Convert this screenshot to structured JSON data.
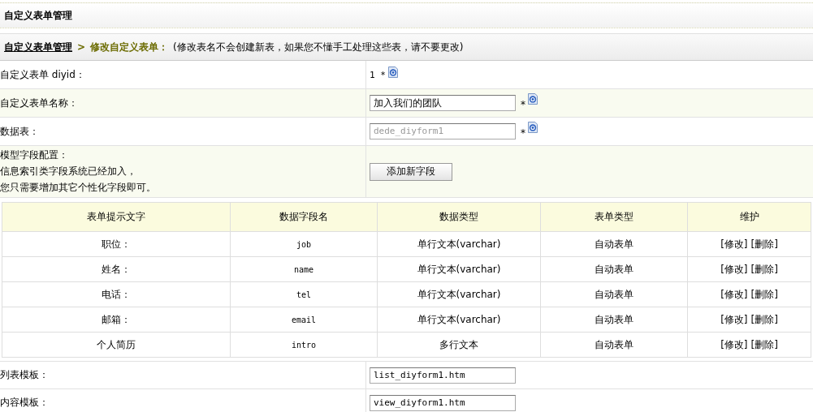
{
  "header": {
    "title": "自定义表单管理"
  },
  "breadcrumb": {
    "link": "自定义表单管理",
    "separator": ">",
    "current": "修改自定义表单：",
    "note": "(修改表名不会创建新表，如果您不懂手工处理这些表，请不要更改)"
  },
  "form_rows": [
    {
      "kind": "text",
      "label": "自定义表单 diyid：",
      "value": "1 *",
      "help": true
    },
    {
      "kind": "input",
      "label": "自定义表单名称：",
      "value": "加入我们的团队",
      "disabled": false,
      "required": "*",
      "help": true
    },
    {
      "kind": "input",
      "label": "数据表：",
      "value": "dede_diyform1",
      "disabled": true,
      "required": "*",
      "help": true
    },
    {
      "kind": "button",
      "label_lines": [
        "模型字段配置：",
        "信息索引类字段系统已经加入，",
        "您只需要增加其它个性化字段即可。"
      ],
      "button": "添加新字段"
    }
  ],
  "fields_table": {
    "columns": [
      "表单提示文字",
      "数据字段名",
      "数据类型",
      "表单类型",
      "维护"
    ],
    "rows": [
      {
        "prompt": "职位：",
        "field": "job",
        "data_type": "单行文本(varchar)",
        "form_type": "自动表单",
        "actions": [
          "[修改]",
          "[删除]"
        ]
      },
      {
        "prompt": "姓名：",
        "field": "name",
        "data_type": "单行文本(varchar)",
        "form_type": "自动表单",
        "actions": [
          "[修改]",
          "[删除]"
        ]
      },
      {
        "prompt": "电话：",
        "field": "tel",
        "data_type": "单行文本(varchar)",
        "form_type": "自动表单",
        "actions": [
          "[修改]",
          "[删除]"
        ]
      },
      {
        "prompt": "邮箱：",
        "field": "email",
        "data_type": "单行文本(varchar)",
        "form_type": "自动表单",
        "actions": [
          "[修改]",
          "[删除]"
        ]
      },
      {
        "prompt": "个人简历",
        "field": "intro",
        "data_type": "多行文本",
        "form_type": "自动表单",
        "actions": [
          "[修改]",
          "[删除]"
        ]
      }
    ]
  },
  "template_rows": [
    {
      "label": "列表模板：",
      "value": "list_diyform1.htm"
    },
    {
      "label": "内容模板：",
      "value": "view_diyform1.htm"
    }
  ]
}
